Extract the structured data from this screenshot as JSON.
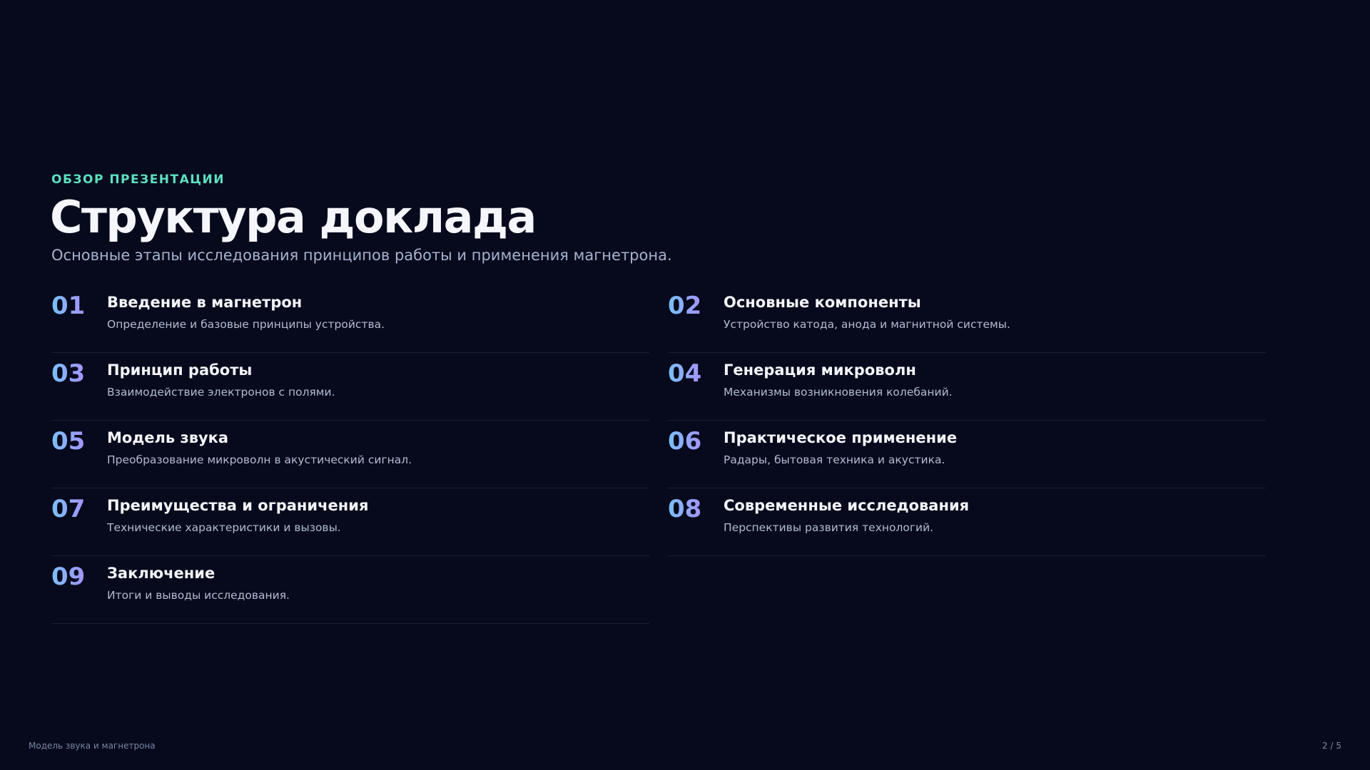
{
  "slide": {
    "eyebrow": "ОБЗОР ПРЕЗЕНТАЦИИ",
    "title": "Структура доклада",
    "subtitle": "Основные этапы исследования принципов работы и применения магнетрона."
  },
  "items": [
    {
      "number": "01",
      "title": "Введение в магнетрон",
      "description": "Определение и базовые принципы устройства."
    },
    {
      "number": "02",
      "title": "Основные компоненты",
      "description": "Устройство катода, анода и магнитной системы."
    },
    {
      "number": "03",
      "title": "Принцип работы",
      "description": "Взаимодействие электронов с полями."
    },
    {
      "number": "04",
      "title": "Генерация микроволн",
      "description": "Механизмы возникновения колебаний."
    },
    {
      "number": "05",
      "title": "Модель звука",
      "description": "Преобразование микроволн в акустический сигнал."
    },
    {
      "number": "06",
      "title": "Практическое применение",
      "description": "Радары, бытовая техника и акустика."
    },
    {
      "number": "07",
      "title": "Преимущества и ограничения",
      "description": "Технические характеристики и вызовы."
    },
    {
      "number": "08",
      "title": "Современные исследования",
      "description": "Перспективы развития технологий."
    },
    {
      "number": "09",
      "title": "Заключение",
      "description": "Итоги и выводы исследования."
    }
  ],
  "footer": {
    "presentation_title": "Модель звука и магнетрона",
    "page_indicator": "2 / 5"
  },
  "colors": {
    "background": "#060a1c",
    "accent_eyebrow": "#5ee0c0",
    "number_gradient_start": "#79c0f5",
    "number_gradient_end": "#a593ff"
  }
}
